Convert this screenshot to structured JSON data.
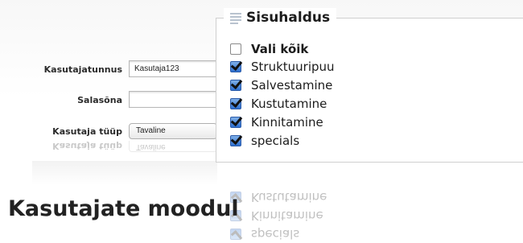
{
  "form": {
    "username_label": "Kasutajatunnus",
    "username_value": "Kasutaja123",
    "password_label": "Salasõna",
    "password_value": "",
    "usertype_label": "Kasutaja tüüp",
    "usertype_value": "Tavaline"
  },
  "content_panel": {
    "title": "Sisuhaldus",
    "items": [
      {
        "label": "Vali kõik",
        "checked": false
      },
      {
        "label": "Struktuuripuu",
        "checked": true
      },
      {
        "label": "Salvestamine",
        "checked": true
      },
      {
        "label": "Kustutamine",
        "checked": true
      },
      {
        "label": "Kinnitamine",
        "checked": true
      },
      {
        "label": "specials",
        "checked": true
      }
    ]
  },
  "page_title": "Kasutajate moodul"
}
